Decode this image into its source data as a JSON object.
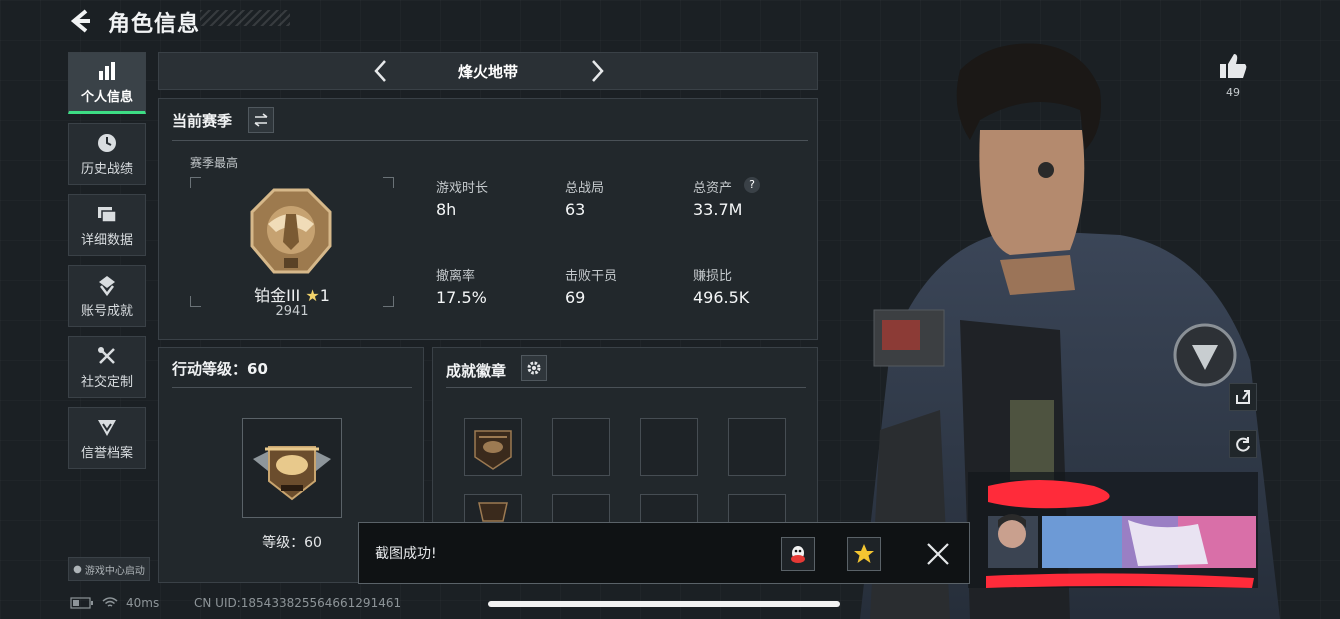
{
  "header": {
    "title": "角色信息"
  },
  "nav": {
    "items": [
      {
        "label": "个人信息",
        "icon": "bar-chart-icon",
        "active": true
      },
      {
        "label": "历史战绩",
        "icon": "clock-icon",
        "active": false
      },
      {
        "label": "详细数据",
        "icon": "cards-icon",
        "active": false
      },
      {
        "label": "账号成就",
        "icon": "medal-icon",
        "active": false
      },
      {
        "label": "社交定制",
        "icon": "tools-icon",
        "active": false
      },
      {
        "label": "信誉档案",
        "icon": "shield-icon",
        "active": false
      }
    ],
    "game_center": "游戏中心启动"
  },
  "mode": {
    "name": "烽火地带"
  },
  "season": {
    "title": "当前赛季",
    "best_label": "赛季最高",
    "rank_name": "铂金III",
    "rank_stars": "1",
    "rank_score": "2941",
    "stats": [
      {
        "label": "游戏时长",
        "value": "8h"
      },
      {
        "label": "总战局",
        "value": "63"
      },
      {
        "label": "总资产",
        "value": "33.7M"
      },
      {
        "label": "撤离率",
        "value": "17.5%"
      },
      {
        "label": "击败干员",
        "value": "69"
      },
      {
        "label": "赚损比",
        "value": "496.5K"
      }
    ],
    "help": "?"
  },
  "level": {
    "title": "行动等级：60",
    "text": "等级：60"
  },
  "badges": {
    "title": "成就徽章"
  },
  "toast": {
    "text": "截图成功!"
  },
  "status": {
    "ping": "40ms",
    "uid": "CN UID:185433825564661291461"
  },
  "likes": {
    "count": "49"
  },
  "colors": {
    "accent": "#3ddc84",
    "background": "#1b2024",
    "panel": "#22282c"
  }
}
